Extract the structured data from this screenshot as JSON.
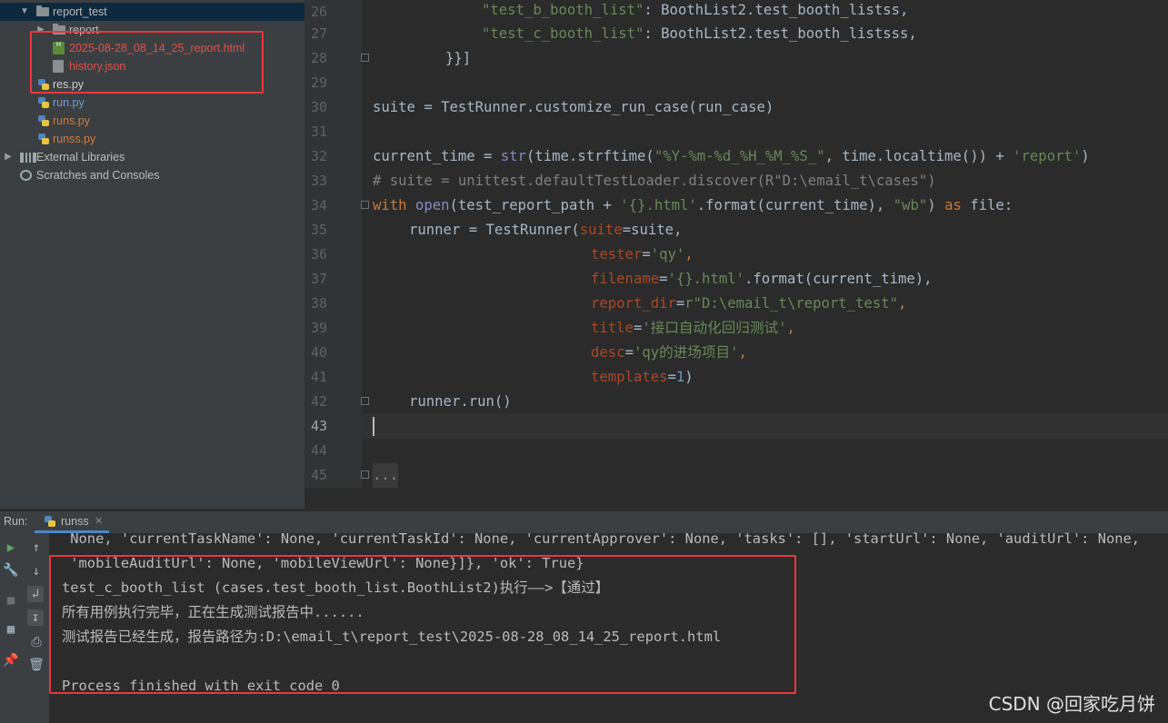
{
  "project": {
    "items": [
      {
        "label": "report_test",
        "type": "folder",
        "expanded": true
      },
      {
        "label": "report",
        "type": "folder",
        "expanded": false
      },
      {
        "label": "2025-08-28_08_14_25_report.html",
        "type": "html"
      },
      {
        "label": "history.json",
        "type": "json"
      },
      {
        "label": "res.py",
        "type": "py"
      },
      {
        "label": "run.py",
        "type": "py"
      },
      {
        "label": "runs.py",
        "type": "py"
      },
      {
        "label": "runss.py",
        "type": "py"
      },
      {
        "label": "External Libraries",
        "type": "lib"
      },
      {
        "label": "Scratches and Consoles",
        "type": "scratch"
      }
    ]
  },
  "editor": {
    "line_numbers": [
      "26",
      "27",
      "28",
      "29",
      "30",
      "31",
      "32",
      "33",
      "34",
      "35",
      "36",
      "37",
      "38",
      "39",
      "40",
      "41",
      "42",
      "43",
      "44",
      "45"
    ],
    "current_line": "43",
    "code": {
      "l26_key": "\"test_b_booth_list\"",
      "l26_rest": ": BoothList2.test_booth_listss,",
      "l27_key": "\"test_c_booth_list\"",
      "l27_rest": ": BoothList2.test_booth_listsss,",
      "l28": "}}]",
      "l30": "suite = TestRunner.customize_run_case(run_case)",
      "l32_a": "current_time = ",
      "l32_str": "str",
      "l32_b": "(time.strftime(",
      "l32_fmt": "\"%Y-%m-%d_%H_%M_%S_\"",
      "l32_c": ", time.localtime()) + ",
      "l32_rep": "'report'",
      "l32_d": ")",
      "l33": "# suite = unittest.defaultTestLoader.discover(R\"D:\\email_t\\cases\")",
      "l34_with": "with",
      "l34_open": "open",
      "l34_a": "(test_report_path + ",
      "l34_html": "'{}.html'",
      "l34_b": ".format(current_time), ",
      "l34_wb": "\"wb\"",
      "l34_c": ") ",
      "l34_as": "as",
      "l34_d": " file:",
      "l35_a": "runner = TestRunner(",
      "l35_p": "suite",
      "l35_b": "=suite,",
      "l36_p": "tester",
      "l36_eq": "=",
      "l36_v": "'qy'",
      "l36_c": ",",
      "l37_p": "filename",
      "l37_eq": "=",
      "l37_v": "'{}.html'",
      "l37_c": ".format(current_time),",
      "l38_p": "report_dir",
      "l38_eq": "=",
      "l38_v": "r\"D:\\email_t\\report_test\"",
      "l38_c": ",",
      "l39_p": "title",
      "l39_eq": "=",
      "l39_v": "'接口自动化回归测试'",
      "l39_c": ",",
      "l40_p": "desc",
      "l40_eq": "=",
      "l40_v": "'qy的进场项目'",
      "l40_c": ",",
      "l41_p": "templates",
      "l41_eq": "=",
      "l41_v": "1",
      "l41_c": ")",
      "l42": "runner.run()",
      "l45": "..."
    }
  },
  "run": {
    "label": "Run:",
    "tab": "runss",
    "output": [
      " None, 'currentTaskName': None, 'currentTaskId': None, 'currentApprover': None, 'tasks': [], 'startUrl': None, 'auditUrl': None,",
      " 'mobileAuditUrl': None, 'mobileViewUrl': None}]}, 'ok': True}",
      "test_c_booth_list (cases.test_booth_list.BoothList2)执行——>【通过】",
      "所有用例执行完毕，正在生成测试报告中......",
      "测试报告已经生成，报告路径为:D:\\email_t\\report_test\\2025-08-28_08_14_25_report.html",
      "",
      "Process finished with exit code 0"
    ]
  },
  "watermark": "CSDN @回家吃月饼",
  "colors": {
    "highlight_box": "#e8383d",
    "keyword": "#cc7832",
    "string": "#6a8759",
    "param": "#aa4926"
  }
}
